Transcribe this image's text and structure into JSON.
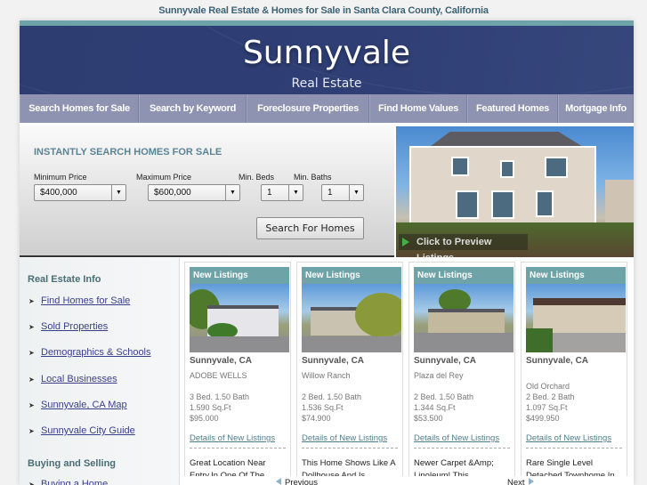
{
  "page_title": "Sunnyvale Real Estate & Homes for Sale in Santa Clara County, California",
  "header": {
    "brand_name": "Sunnyvale",
    "brand_sub": "Real Estate"
  },
  "nav": {
    "items": [
      {
        "label": "Search Homes for Sale"
      },
      {
        "label": "Search by Keyword"
      },
      {
        "label": "Foreclosure Properties"
      },
      {
        "label": "Find Home Values"
      },
      {
        "label": "Featured Homes"
      },
      {
        "label": "Mortgage Info"
      }
    ]
  },
  "search": {
    "heading": "INSTANTLY SEARCH HOMES FOR SALE",
    "min_price": {
      "label": "Minimum Price",
      "value": "$400,000"
    },
    "max_price": {
      "label": "Maximum Price",
      "value": "$600,000"
    },
    "min_beds": {
      "label": "Min. Beds",
      "value": "1"
    },
    "min_baths": {
      "label": "Min. Baths",
      "value": "1"
    },
    "button": "Search For Homes",
    "dropdown_arrow": "▼"
  },
  "hero": {
    "caption": "Click to Preview Listings",
    "icon": "green-arrow-icon"
  },
  "sidebar": {
    "sections": [
      {
        "heading": "Real Estate Info",
        "items": [
          {
            "label": "Find Homes for Sale"
          },
          {
            "label": "Sold Properties"
          },
          {
            "label": "Demographics & Schools"
          },
          {
            "label": "Local Businesses"
          },
          {
            "label": "Sunnyvale, CA Map"
          },
          {
            "label": "Sunnyvale City Guide"
          }
        ]
      },
      {
        "heading": "Buying and Selling",
        "items": [
          {
            "label": "Buying a Home"
          }
        ]
      }
    ],
    "bullet": "➤"
  },
  "listings": {
    "cards": [
      {
        "badge": "New Listings",
        "city": "Sunnyvale, CA",
        "community": "ADOBE WELLS",
        "beds_baths": "3 Bed. 1.50 Bath",
        "sqft": "1.590 Sq.Ft",
        "price": "$95.000",
        "link": "Details of New Listings",
        "desc_1": "Great Location Near",
        "desc_2": "Entry,In One Of The"
      },
      {
        "badge": "New Listings",
        "city": "Sunnyvale, CA",
        "community": "Willow Ranch",
        "beds_baths": "2 Bed. 1.50 Bath",
        "sqft": "1.536 Sq.Ft",
        "price": "$74.900",
        "link": "Details of New Listings",
        "desc_1": "This Home Shows Like A",
        "desc_2": "Dollhouse And Is"
      },
      {
        "badge": "New Listings",
        "city": "Sunnyvale, CA",
        "community": "Plaza del Rey",
        "beds_baths": "2 Bed. 1.50 Bath",
        "sqft": "1.344 Sq.Ft",
        "price": "$53.500",
        "link": "Details of New Listings",
        "desc_1": "Newer Carpet &Amp;",
        "desc_2": "Linoleum! This"
      },
      {
        "badge": "New Listings",
        "city": "Sunnyvale, CA",
        "community": "Old Orchard",
        "beds_baths": "2 Bed. 2 Bath",
        "sqft": "1.097 Sq.Ft",
        "price": "$499.950",
        "link": "Details of New Listings",
        "desc_1": "Rare Single Level",
        "desc_2": "Detached Townhome In"
      }
    ],
    "previous": "Previous",
    "next": "Next"
  },
  "colors": {
    "banner": "#2f3f76",
    "nav": "#8d93b1",
    "teal_accent": "#6ea4a8",
    "link": "#3a3f8a"
  }
}
